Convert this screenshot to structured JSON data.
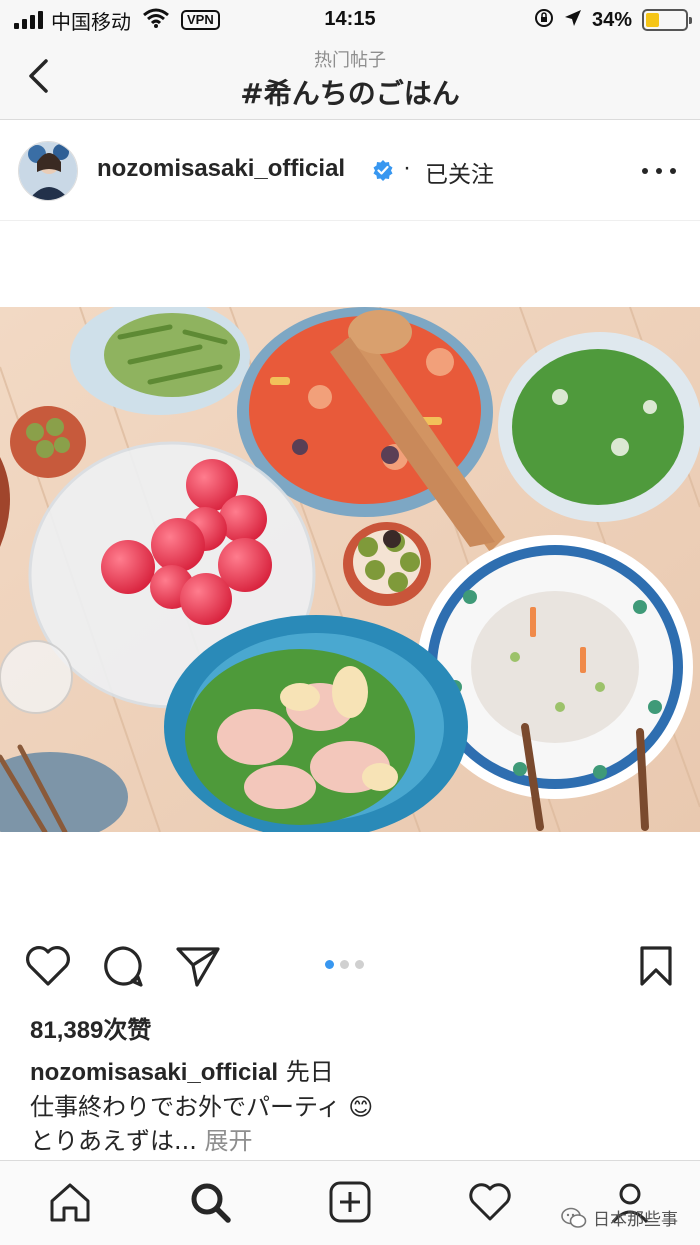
{
  "status_bar": {
    "carrier": "中国移动",
    "vpn_label": "VPN",
    "time": "14:15",
    "battery_pct": "34%",
    "battery_level": 0.34,
    "battery_color": "#f5c518"
  },
  "header": {
    "subtitle": "热门帖子",
    "title": "#希んちのごはん",
    "back_icon": "chevron-left-icon"
  },
  "post": {
    "username": "nozomisasaki_official",
    "follow_separator": "·",
    "follow_status": "已关注",
    "verified_color": "#3897f0"
  },
  "carousel": {
    "count": 3,
    "active_index": 0,
    "active_color": "#3897f0"
  },
  "likes": "81,389次赞",
  "caption": {
    "username": "nozomisasaki_official",
    "line1": " 先日",
    "line2": "仕事終わりでお外でパーティ 😊",
    "line3": "とりあえずは...",
    "more_label": " 展开"
  },
  "bottom_nav": {
    "items": [
      "home-icon",
      "search-icon",
      "add-post-icon",
      "heart-icon",
      "profile-icon"
    ]
  },
  "watermark": "日本那些事"
}
